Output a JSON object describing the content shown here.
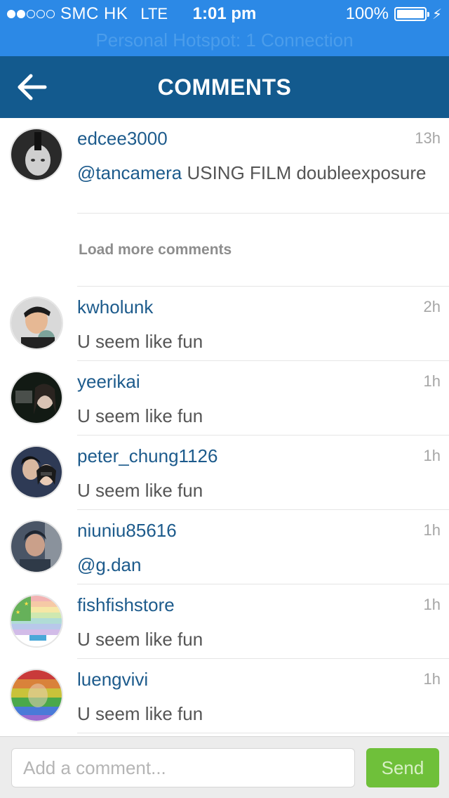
{
  "status_bar": {
    "carrier": "SMC HK",
    "network": "LTE",
    "time": "1:01 pm",
    "battery": "100%",
    "battery_level": 1.0,
    "signal_bars_filled": 2,
    "signal_bars_total": 5,
    "hotspot": "Personal Hotspot: 1 Connection"
  },
  "nav": {
    "back_icon": "arrow-left-icon",
    "title": "COMMENTS"
  },
  "comments": [
    {
      "username": "edcee3000",
      "time": "13h",
      "mention": "@tancamera",
      "text": " USING FILM doubleexposure"
    },
    {
      "username": "kwholunk",
      "time": "2h",
      "mention": "",
      "text": "U seem like fun"
    },
    {
      "username": "yeerikai",
      "time": "1h",
      "mention": "",
      "text": "U seem like fun"
    },
    {
      "username": "peter_chung1126",
      "time": "1h",
      "mention": "",
      "text": "U seem like fun"
    },
    {
      "username": "niuniu85616",
      "time": "1h",
      "mention": "@g.dan",
      "text": ""
    },
    {
      "username": "fishfishstore",
      "time": "1h",
      "mention": "",
      "text": "U seem like fun"
    },
    {
      "username": "luengvivi",
      "time": "1h",
      "mention": "",
      "text": "U seem like fun"
    }
  ],
  "load_more": "Load more comments",
  "composer": {
    "placeholder": "Add a comment...",
    "send_label": "Send"
  },
  "colors": {
    "status_bar": "#2c89e6",
    "nav_bar": "#135a8e",
    "username": "#1d5b8c",
    "send": "#6fc03a"
  }
}
